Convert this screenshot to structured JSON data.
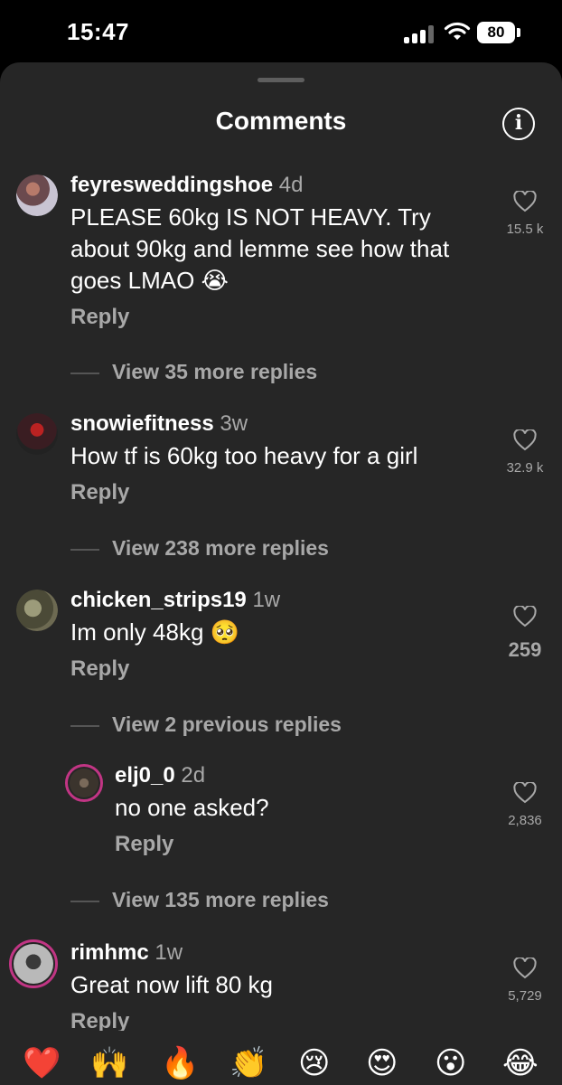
{
  "status_bar": {
    "time": "15:47",
    "battery": "80"
  },
  "header": {
    "title": "Comments",
    "info_icon": "info-icon"
  },
  "comments": [
    {
      "username": "feyresweddingshoe",
      "time": "4d",
      "text_lines": [
        "PLEASE 60kg IS NOT HEAVY. Try",
        "about 90kg and lemme see how that",
        "goes LMAO 😭"
      ],
      "reply_label": "Reply",
      "likes": "15.5 k",
      "view_replies": "View 35 more replies"
    },
    {
      "username": "snowiefitness",
      "time": "3w",
      "text_lines": [
        "How tf is 60kg too heavy for a girl"
      ],
      "reply_label": "Reply",
      "likes": "32.9 k",
      "view_replies": "View 238 more replies"
    },
    {
      "username": "chicken_strips19",
      "time": "1w",
      "text_lines": [
        "Im only 48kg 🥺"
      ],
      "reply_label": "Reply",
      "likes": "259",
      "view_replies": "View 2 previous replies"
    },
    {
      "username": "elj0_0",
      "time": "2d",
      "text_lines": [
        "no one asked?"
      ],
      "reply_label": "Reply",
      "likes": "2,836",
      "view_replies": "View 135 more replies"
    },
    {
      "username": "rimhmc",
      "time": "1w",
      "text_lines": [
        "Great now lift 80 kg"
      ],
      "reply_label": "Reply",
      "likes": "5,729"
    }
  ],
  "emoji_bar": [
    "❤️",
    "🙌",
    "🔥",
    "👏",
    "😢",
    "😍",
    "😮",
    "😂"
  ]
}
